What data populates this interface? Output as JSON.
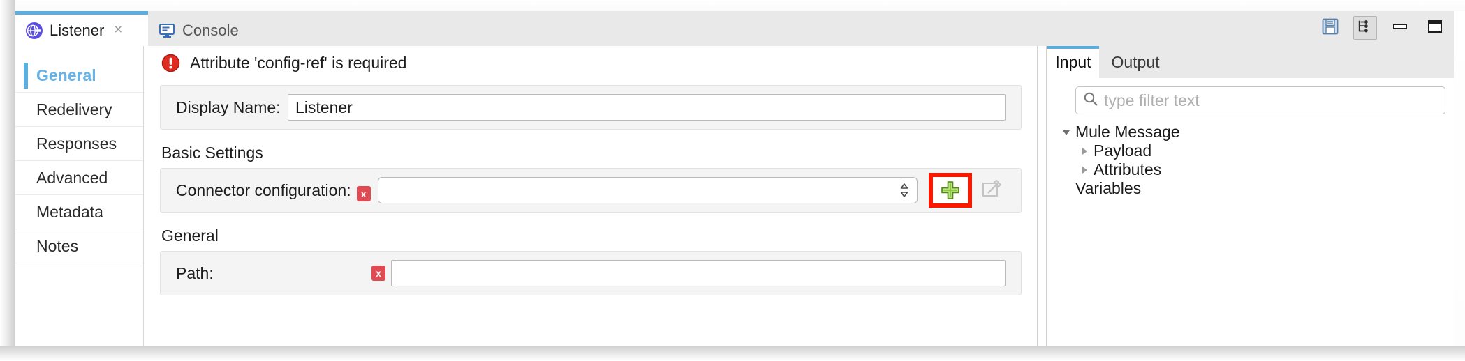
{
  "window": {
    "tabs": [
      {
        "id": "listener",
        "label": "Listener",
        "icon": "http-listener-icon",
        "active": true,
        "closable": true,
        "close_glyph": "×"
      },
      {
        "id": "console",
        "label": "Console",
        "icon": "console-monitor-icon",
        "active": false,
        "closable": false
      }
    ],
    "toolbar": [
      {
        "id": "save",
        "icon": "save-floppy-icon",
        "pressed": false
      },
      {
        "id": "link-tree",
        "icon": "tree-hierarchy-icon",
        "pressed": true
      },
      {
        "id": "minimize",
        "icon": "minimize-icon",
        "pressed": false
      },
      {
        "id": "maximize",
        "icon": "maximize-icon",
        "pressed": false
      }
    ]
  },
  "sidebar": {
    "items": [
      {
        "label": "General",
        "active": true
      },
      {
        "label": "Redelivery",
        "active": false
      },
      {
        "label": "Responses",
        "active": false
      },
      {
        "label": "Advanced",
        "active": false
      },
      {
        "label": "Metadata",
        "active": false
      },
      {
        "label": "Notes",
        "active": false
      }
    ]
  },
  "form": {
    "error": {
      "icon": "error-circle-icon",
      "message": "Attribute 'config-ref' is required"
    },
    "display_name": {
      "label": "Display Name:",
      "value": "Listener",
      "placeholder": ""
    },
    "basic_settings": {
      "heading": "Basic Settings",
      "connector_configuration": {
        "label": "Connector configuration:",
        "value": "",
        "placeholder": "",
        "error_badge": "x",
        "add_button_icon": "plus-icon",
        "edit_button_icon": "edit-pencil-icon",
        "dropdown_icon": "stepper-arrows-icon",
        "highlight_color": "#fb1800"
      }
    },
    "general": {
      "heading": "General",
      "path": {
        "label": "Path:",
        "value": "",
        "placeholder": "",
        "error_badge": "x"
      }
    }
  },
  "io_panel": {
    "tabs": [
      {
        "label": "Input",
        "active": true
      },
      {
        "label": "Output",
        "active": false
      }
    ],
    "filter": {
      "icon": "search-icon",
      "value": "",
      "placeholder": "type filter text"
    },
    "tree": [
      {
        "label": "Mule Message",
        "level": 1,
        "twisty": "expanded"
      },
      {
        "label": "Payload",
        "level": 2,
        "twisty": "collapsed"
      },
      {
        "label": "Attributes",
        "level": 2,
        "twisty": "collapsed"
      },
      {
        "label": "Variables",
        "level": 1,
        "twisty": "none"
      }
    ]
  },
  "colors": {
    "accent": "#5aaee0",
    "error": "#e04a52",
    "highlight": "#fb1800",
    "plus_green": "#8cc63f"
  }
}
